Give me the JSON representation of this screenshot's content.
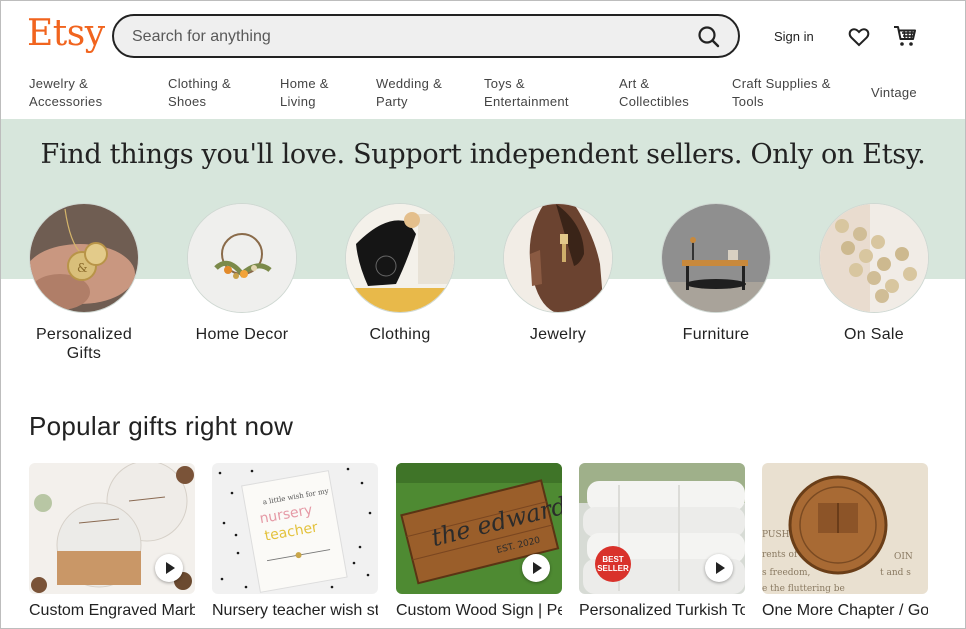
{
  "header": {
    "logo": "Etsy",
    "search_placeholder": "Search for anything",
    "sign_in": "Sign in",
    "favorites_icon": "heart-icon",
    "cart_icon": "cart-icon",
    "search_icon": "search-icon"
  },
  "nav": {
    "items": [
      {
        "line1": "Jewelry &",
        "line2": "Accessories"
      },
      {
        "line1": "Clothing &",
        "line2": "Shoes"
      },
      {
        "line1": "Home &",
        "line2": "Living"
      },
      {
        "line1": "Wedding &",
        "line2": "Party"
      },
      {
        "line1": "Toys &",
        "line2": "Entertainment"
      },
      {
        "line1": "Art &",
        "line2": "Collectibles"
      },
      {
        "line1": "Craft Supplies &",
        "line2": "Tools"
      },
      {
        "line1": "Vintage",
        "line2": ""
      }
    ]
  },
  "hero": {
    "title": "Find things you'll love. Support independent sellers. Only on Etsy."
  },
  "categories": [
    {
      "line1": "Personalized",
      "line2": "Gifts"
    },
    {
      "line1": "Home Decor",
      "line2": ""
    },
    {
      "line1": "Clothing",
      "line2": ""
    },
    {
      "line1": "Jewelry",
      "line2": ""
    },
    {
      "line1": "Furniture",
      "line2": ""
    },
    {
      "line1": "On Sale",
      "line2": ""
    }
  ],
  "popular": {
    "title": "Popular gifts right now",
    "cards": [
      {
        "title": "Custom Engraved Marble Wood"
      },
      {
        "title": "Nursery teacher wish string! Nursery"
      },
      {
        "title": "Custom Wood Sign | Personalized Family"
      },
      {
        "title": "Personalized Turkish Towel, Personalized"
      },
      {
        "title": "One More Chapter / Go to Bed Copper"
      }
    ],
    "badge": "BEST SELLER"
  },
  "colors": {
    "brand": "#f1641e",
    "hero_bg": "#d7e6dc"
  }
}
